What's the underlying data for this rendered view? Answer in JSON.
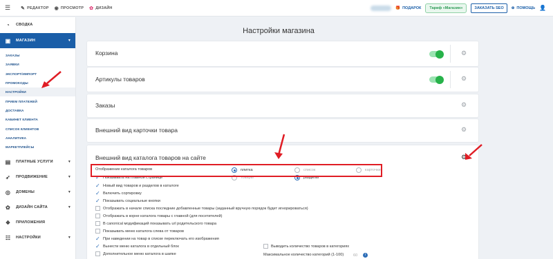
{
  "topbar": {
    "editor": "РЕДАКТОР",
    "preview": "ПРОСМОТР",
    "design": "ДИЗАЙН",
    "gift": "ПОДАРОК",
    "tariff": "Тариф «Магазин»",
    "seo": "ЗАКАЗАТЬ SEO",
    "help": "ПОМОЩЬ"
  },
  "sidebar": {
    "summary": "СВОДКА",
    "shop": "МАГАЗИН",
    "shop_items": [
      "ЗАКАЗЫ",
      "ЗАЯВКИ",
      "ЭКСПОРТ/ИМПОРТ",
      "ПРОМОКОДЫ",
      "НАСТРОЙКИ",
      "ПРИЕМ ПЛАТЕЖЕЙ",
      "ДОСТАВКА",
      "КАБИНЕТ КЛИЕНТА",
      "СПИСОК КЛИЕНТОВ",
      "АНАЛИТИКА",
      "МАРКЕТПЛЕЙСЫ"
    ],
    "paid": "ПЛАТНЫЕ УСЛУГИ",
    "promo": "ПРОДВИЖЕНИЕ",
    "domains": "ДОМЕНЫ",
    "site_design": "ДИЗАЙН САЙТА",
    "apps": "ПРИЛОЖЕНИЯ",
    "settings": "НАСТРОЙКИ"
  },
  "main": {
    "title": "Настройки магазина",
    "cards": [
      "Корзина",
      "Артикулы товаров",
      "Заказы",
      "Внешний вид карточки товара",
      "Внешний вид каталога товаров на сайте"
    ],
    "catalog": {
      "display_label": "Отображение каталога товаров",
      "display_options": [
        "плитка",
        "список",
        "карточки"
      ],
      "show_main": "Показывать на главной странице",
      "show_main_options": [
        "товары",
        "разделы"
      ],
      "options": [
        {
          "label": "Новый вид товаров и разделов в каталоге",
          "checked": true
        },
        {
          "label": "Включить сортировку",
          "checked": true
        },
        {
          "label": "Показывать социальные кнопки",
          "checked": true
        },
        {
          "label": "Отображать в начале списка последние добавленные товары (заданный вручную порядок будет игнорироваться)",
          "checked": false
        },
        {
          "label": "Отображать в корне каталога товары с главной (для посетителей)",
          "checked": false
        },
        {
          "label": "В canonical модификаций показывать url родительского товара",
          "checked": false
        },
        {
          "label": "Показывать меню каталога слева от товаров",
          "checked": false
        },
        {
          "label": "При наведении на товар в списке переключать его изображения",
          "checked": true
        },
        {
          "label": "Вынести меню каталога в отдельный блок",
          "checked": true
        },
        {
          "label": "Дополнительное меню каталога в шапке",
          "checked": false
        }
      ],
      "count_label": "Выводить количество товаров в категориях",
      "max_cat_label": "Максимальное количество категорий (1-100)",
      "max_cat_value": "60"
    }
  }
}
